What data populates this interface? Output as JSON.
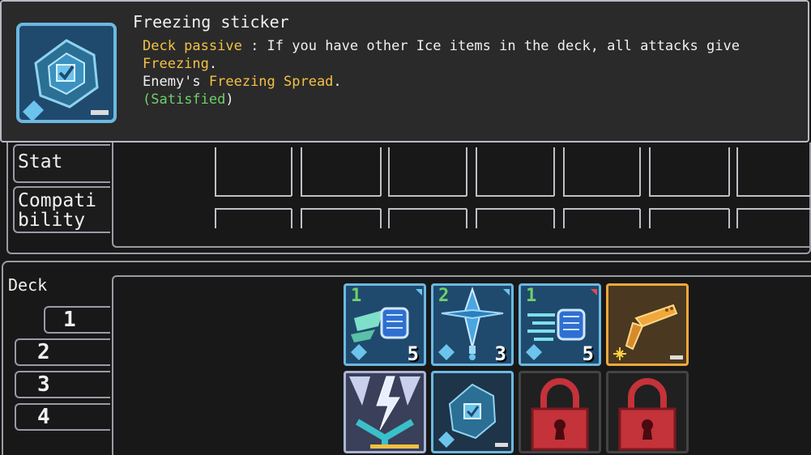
{
  "tooltip": {
    "title": "Freezing sticker",
    "passive_label": "Deck passive",
    "passive_sep": " : ",
    "line1_text": "If you have other Ice items in the deck, all attacks give ",
    "line1_kw": "Freezing",
    "line1_end": ".",
    "line2_text": "Enemy's ",
    "line2_kw": "Freezing Spread",
    "line2_end": ".",
    "status_open": "(",
    "status": "Satisfied",
    "status_close": ")",
    "icon": "freezing-sticker-icon"
  },
  "tabs": {
    "stat": "Stat",
    "compat_line1": "Compati",
    "compat_line2": "bility"
  },
  "deck": {
    "label": "Deck",
    "tabs": [
      "1",
      "2",
      "3",
      "4"
    ],
    "active_tab": "1",
    "cards": [
      {
        "icon": "ice-fist-dash-icon",
        "level": "1",
        "count": "5",
        "color": "#6cb8e0"
      },
      {
        "icon": "ice-sword-icon",
        "level": "2",
        "count": "3",
        "color": "#6cb8e0"
      },
      {
        "icon": "ice-fist-punch-icon",
        "level": "1",
        "count": "5",
        "color": "#6cb8e0"
      },
      {
        "icon": "golden-gun-icon",
        "level": "",
        "count": "",
        "color": "#f0a83a"
      },
      {
        "icon": "lightning-chevron-icon",
        "level": "",
        "count": "",
        "color": "#aab4d6"
      },
      {
        "icon": "freezing-sticker-icon",
        "level": "",
        "count": "",
        "color": "#6cb8e0"
      },
      {
        "icon": "locked-slot-icon",
        "level": "",
        "count": "",
        "color": "#444444"
      },
      {
        "icon": "locked-slot-icon",
        "level": "",
        "count": "",
        "color": "#444444"
      }
    ]
  },
  "colors": {
    "keyword": "#f4c144",
    "satisfied": "#6fd06a",
    "panel_border": "#9a9aa6",
    "background": "#181818"
  }
}
